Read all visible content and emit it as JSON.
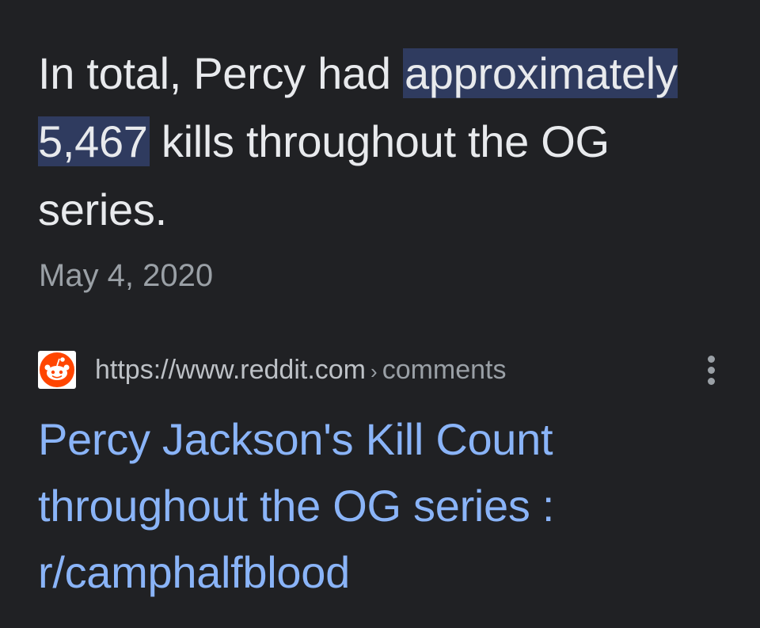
{
  "snippet": {
    "before": "In total, Percy had ",
    "highlight": "approximately 5,467",
    "after": " kills throughout the OG series."
  },
  "date": "May 4, 2020",
  "result": {
    "favicon": "reddit-icon",
    "url_domain": "https://www.reddit.com",
    "url_separator": "›",
    "url_path": "comments",
    "menu_icon": "more-vert-icon",
    "title": "Percy Jackson's Kill Count throughout the OG series : r/camphalfblood"
  },
  "colors": {
    "background": "#202124",
    "text": "#e8eaed",
    "highlight_bg": "#2f3b5f",
    "muted": "#9aa0a6",
    "link": "#8ab4f8",
    "reddit_orange": "#ff4500"
  }
}
